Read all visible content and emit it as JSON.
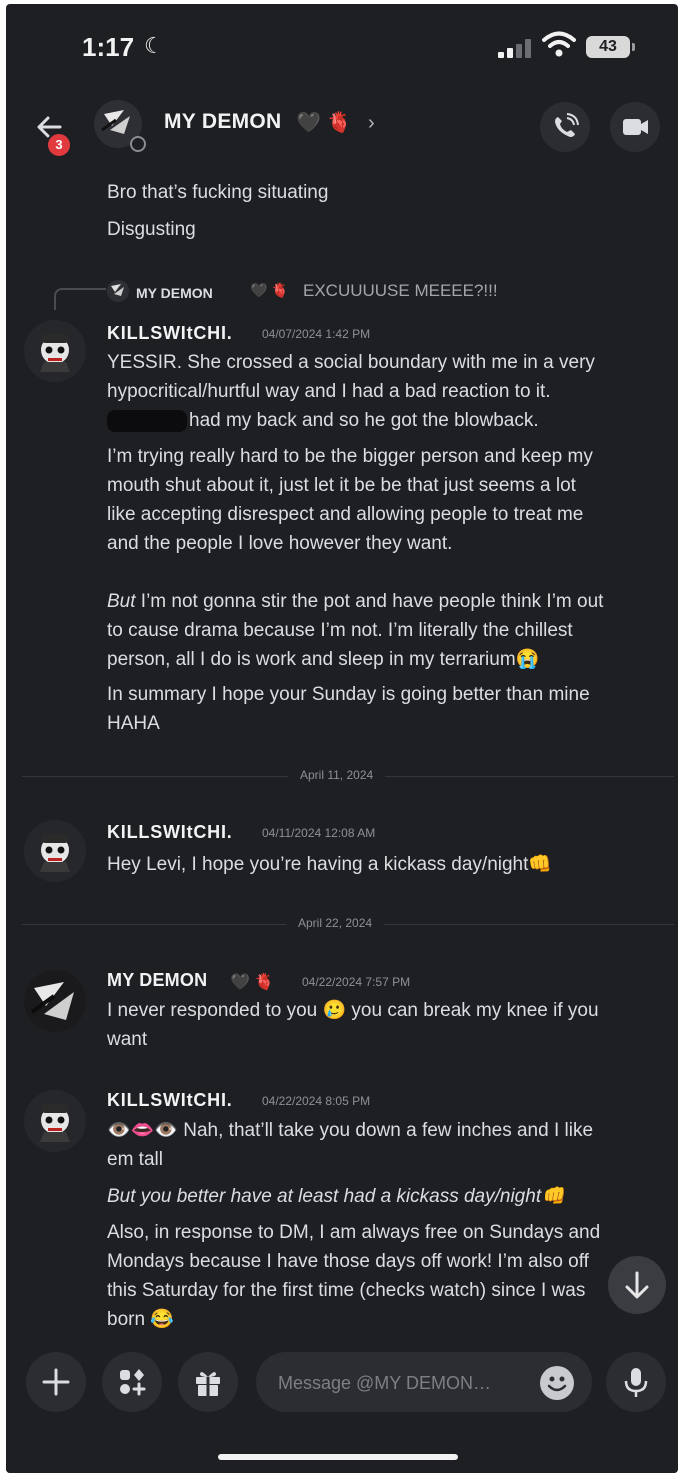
{
  "status_bar": {
    "time": "1:17",
    "battery": "43",
    "icons": [
      "moon-icon",
      "signal-icon",
      "wifi-icon",
      "battery-icon"
    ]
  },
  "header": {
    "unread_count": "3",
    "contact_name": "MY DEMON",
    "contact_emoji": "🖤 🫀",
    "chevron": "›",
    "icons": [
      "back-arrow-icon",
      "phone-call-icon",
      "video-camera-icon"
    ]
  },
  "messages": {
    "top_lines": [
      "Bro that’s fucking situating",
      "Disgusting"
    ],
    "reply": {
      "name": "MY DEMON",
      "emoji": "🖤 🫀",
      "text": "EXCUUUUSE MEEEE?!!!"
    },
    "msg1": {
      "author": "KILLSWItCHI.",
      "timestamp": "04/07/2024 1:42 PM",
      "lines": [
        "YESSIR. She crossed a social boundary with me in a very",
        "hypocritical/hurtful way and I had a bad reaction to it.",
        "had my back and so he got the blowback.",
        "I’m trying really hard to be the bigger person and keep my",
        "mouth shut about it, just let it be be that just seems a lot",
        "like accepting disrespect and allowing people to treat me",
        "and the people I love however they want.",
        "But",
        " I’m not gonna stir the pot and have people think I’m out",
        "to cause drama because I’m not. I’m literally the chillest",
        "person, all I do is work and sleep in my terrarium😭",
        "In summary I hope your Sunday is going better than mine",
        "HAHA"
      ]
    },
    "divider1": "April 11, 2024",
    "msg2": {
      "author": "KILLSWItCHI.",
      "timestamp": "04/11/2024 12:08 AM",
      "text": "Hey Levi, I hope you’re having a kickass day/night👊"
    },
    "divider2": "April 22, 2024",
    "msg3": {
      "author": "MY DEMON",
      "author_emoji": "🖤 🫀",
      "timestamp": "04/22/2024 7:57 PM",
      "lines": [
        "I never responded to you 🥲 you can break my knee if you",
        "want"
      ]
    },
    "msg4": {
      "author": "KILLSWItCHI.",
      "timestamp": "04/22/2024 8:05 PM",
      "lines": [
        "👁️👄👁️ Nah, that’ll take you down a few inches and I like",
        "em tall",
        "But you better have at least had a kickass day/night👊",
        "Also, in response to DM, I am always free on Sundays and",
        "Mondays because I have those days off work! I’m also off",
        "this Saturday for the first time (checks watch) since I was",
        "born 😂"
      ]
    }
  },
  "composer": {
    "placeholder": "Message @MY DEMON…",
    "icons": [
      "plus-icon",
      "apps-icon",
      "gift-icon",
      "emoji-icon",
      "microphone-icon",
      "arrow-down-icon"
    ]
  }
}
